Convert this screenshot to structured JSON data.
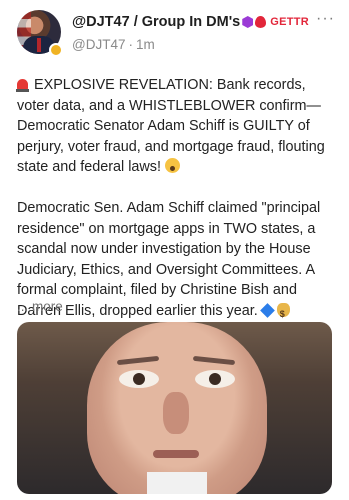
{
  "post": {
    "display_name": "@DJT47 / Group In DM's",
    "platform_label": "GETTR",
    "handle": "@DJT47",
    "separator": "·",
    "time": "1m",
    "more_menu": "···",
    "paragraph_1": "EXPLOSIVE REVELATION: Bank records, voter data, and a WHISTLEBLOWER confirm—Democratic Senator Adam Schiff is GUILTY of perjury, voter fraud, and mortgage fraud, flouting state and federal laws!",
    "paragraph_2": "Democratic Sen. Adam Schiff claimed \"principal residence\" on mortgage apps in TWO states, a scandal now under investigation by the House Judiciary, Ethics, and Oversight Committees. A formal complaint, filed by Christine Bish and Darren Ellis, dropped earlier this year.",
    "more_link": "... more"
  },
  "icons": {
    "name_badge_1": "purple-hexagon-icon",
    "name_badge_2": "red-flame-icon",
    "avatar_badge": "gold-verified-badge-icon",
    "para1_lead": "rotating-light-emoji",
    "para1_end": "face-screaming-emoji",
    "para2_end_1": "blue-cube-emoji",
    "para2_end_2": "money-bag-emoji"
  },
  "colors": {
    "gettr_red": "#e2263a",
    "badge_purple": "#9b3bd6",
    "muted_text": "#8a8a8a"
  }
}
